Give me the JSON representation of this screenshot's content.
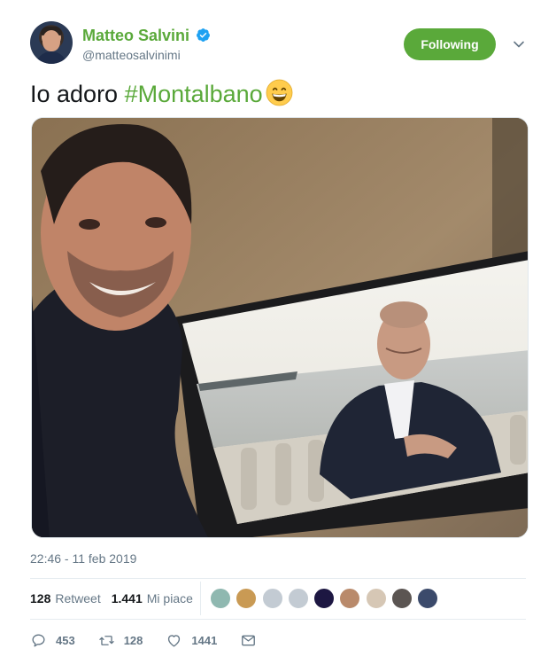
{
  "author": {
    "display_name": "Matteo Salvini",
    "handle": "@matteosalvinimi",
    "verified": true,
    "avatar_icon": "profile-photo"
  },
  "follow_button": {
    "label": "Following",
    "color": "#5aa93a"
  },
  "menu_icon": "chevron-down-icon",
  "tweet": {
    "text_plain": "Io adoro ",
    "hashtag": "#Montalbano",
    "emoji": "grinning-face-emoji",
    "accent_color": "#5aa93a"
  },
  "media": {
    "description_icon": "photo"
  },
  "timestamp": "22:46 - 11 feb 2019",
  "stats": {
    "retweets_count": "128",
    "retweets_label": "Retweet",
    "likes_count": "1.441",
    "likes_label": "Mi piace"
  },
  "likers": [
    "liker-avatar",
    "liker-avatar",
    "liker-avatar",
    "liker-avatar",
    "liker-avatar",
    "liker-avatar",
    "liker-avatar",
    "liker-avatar",
    "liker-avatar"
  ],
  "actions": {
    "reply_icon": "reply-icon",
    "reply_count": "453",
    "retweet_icon": "retweet-icon",
    "retweet_count": "128",
    "like_icon": "heart-icon",
    "like_count": "1441",
    "dm_icon": "envelope-icon"
  }
}
